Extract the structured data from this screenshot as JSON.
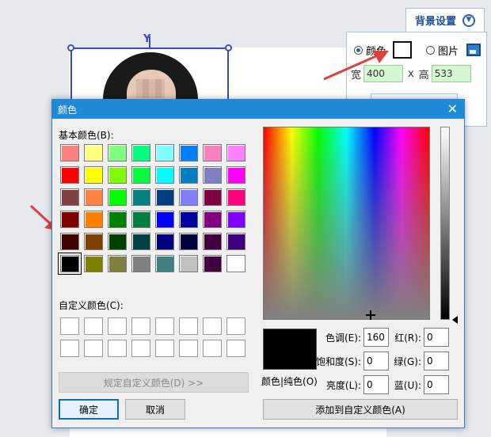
{
  "background_panel": {
    "title": "背景设置",
    "color_option": "颜色",
    "image_option": "图片",
    "width_label": "宽",
    "width_value": "400",
    "times_sign": "x",
    "height_label": "高",
    "height_value": "533",
    "swatch_color": "#ffffff"
  },
  "dialog": {
    "title": "颜色",
    "basic_colors_label": "基本颜色(B):",
    "custom_colors_label": "自定义颜色(C):",
    "define_custom_button": "规定自定义颜色(D) >>",
    "ok_button": "确定",
    "cancel_button": "取消",
    "preview_label": "颜色|纯色(O)",
    "add_custom_button": "添加到自定义颜色(A)",
    "fields": {
      "hue_label": "色调(E):",
      "hue": "160",
      "sat_label": "饱和度(S):",
      "sat": "0",
      "lum_label": "亮度(L):",
      "lum": "0",
      "red_label": "红(R):",
      "red": "0",
      "green_label": "绿(G):",
      "green": "0",
      "blue_label": "蓝(U):",
      "blue": "0"
    },
    "basic_colors": [
      "#ff8080",
      "#ffff80",
      "#80ff80",
      "#00ff80",
      "#80ffff",
      "#0080ff",
      "#ff80c0",
      "#ff80ff",
      "#ff0000",
      "#ffff00",
      "#80ff00",
      "#00ff40",
      "#00ffff",
      "#0080c0",
      "#8080c0",
      "#ff00ff",
      "#804040",
      "#ff8040",
      "#00ff00",
      "#008080",
      "#004080",
      "#8080ff",
      "#800040",
      "#ff0080",
      "#800000",
      "#ff8000",
      "#008000",
      "#008040",
      "#0000ff",
      "#0000a0",
      "#800080",
      "#8000ff",
      "#400000",
      "#804000",
      "#004000",
      "#004040",
      "#000080",
      "#000040",
      "#400040",
      "#400080",
      "#000000",
      "#808000",
      "#808040",
      "#808080",
      "#408080",
      "#c0c0c0",
      "#400040",
      "#ffffff"
    ],
    "selected_index": 40,
    "current_color": "#000000"
  }
}
